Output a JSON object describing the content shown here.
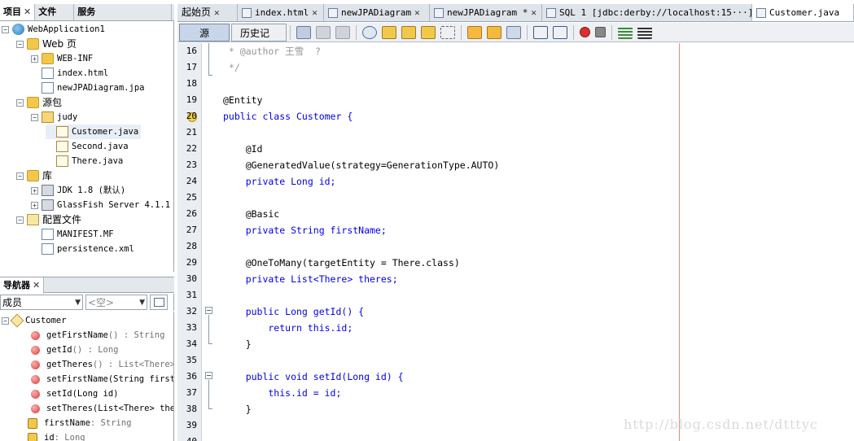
{
  "left_tabs": [
    {
      "label": "项目"
    },
    {
      "label": "文件"
    },
    {
      "label": "服务"
    }
  ],
  "project_tree": [
    {
      "label": "WebApplication1",
      "icon": "globe-icon"
    },
    {
      "label": "Web 页",
      "icon": "folder-icon"
    },
    {
      "label": "WEB-INF",
      "icon": "folder-icon"
    },
    {
      "label": "index.html",
      "icon": "page-icon"
    },
    {
      "label": "newJPADiagram.jpa",
      "icon": "page-icon"
    },
    {
      "label": "源包",
      "icon": "folder-icon"
    },
    {
      "label": "judy",
      "icon": "package-icon"
    },
    {
      "label": "Customer.java",
      "icon": "java-file-icon"
    },
    {
      "label": "Second.java",
      "icon": "java-file-icon"
    },
    {
      "label": "There.java",
      "icon": "java-file-icon"
    },
    {
      "label": "库",
      "icon": "library-icon"
    },
    {
      "label": "JDK 1.8 (默认)",
      "icon": "library-icon"
    },
    {
      "label": "GlassFish Server 4.1.1",
      "icon": "library-icon"
    },
    {
      "label": "配置文件",
      "icon": "config-icon"
    },
    {
      "label": "MANIFEST.MF",
      "icon": "page-icon"
    },
    {
      "label": "persistence.xml",
      "icon": "page-icon"
    }
  ],
  "navigator": {
    "tab_label": "导航器",
    "filter_value": "成员",
    "second_value": "<空>",
    "root": "Customer",
    "members": [
      {
        "name": "getFirstName",
        "sig": "() : String"
      },
      {
        "name": "getId",
        "sig": "() : Long"
      },
      {
        "name": "getTheres",
        "sig": "() : List<There>"
      },
      {
        "name": "setFirstName",
        "sig": "(String firstN"
      },
      {
        "name": "setId",
        "sig": "(Long id)"
      },
      {
        "name": "setTheres",
        "sig": "(List<There> ther"
      },
      {
        "name": "firstName",
        "sig": " : String"
      },
      {
        "name": "id",
        "sig": " : Long"
      }
    ]
  },
  "editor_tabs": [
    {
      "label": "起始页"
    },
    {
      "label": "index.html"
    },
    {
      "label": "newJPADiagram"
    },
    {
      "label": "newJPADiagram *"
    },
    {
      "label": "SQL 1 [jdbc:derby://localhost:15···]"
    },
    {
      "label": "Customer.java"
    }
  ],
  "toolbar": {
    "source_label": "源",
    "history_label": "历史记录"
  },
  "code_lines": [
    {
      "n": "16",
      "text": " * @author 王雪  ?"
    },
    {
      "n": "17",
      "text": " */"
    },
    {
      "n": "18",
      "text": ""
    },
    {
      "n": "19",
      "text": "@Entity"
    },
    {
      "n": "20",
      "text": "public class Customer {"
    },
    {
      "n": "21",
      "text": ""
    },
    {
      "n": "22",
      "text": "    @Id"
    },
    {
      "n": "23",
      "text": "    @GeneratedValue(strategy=GenerationType.AUTO)"
    },
    {
      "n": "24",
      "text": "    private Long id;"
    },
    {
      "n": "25",
      "text": ""
    },
    {
      "n": "26",
      "text": "    @Basic"
    },
    {
      "n": "27",
      "text": "    private String firstName;"
    },
    {
      "n": "28",
      "text": ""
    },
    {
      "n": "29",
      "text": "    @OneToMany(targetEntity = There.class)"
    },
    {
      "n": "30",
      "text": "    private List<There> theres;"
    },
    {
      "n": "31",
      "text": ""
    },
    {
      "n": "32",
      "text": "    public Long getId() {"
    },
    {
      "n": "33",
      "text": "        return this.id;"
    },
    {
      "n": "34",
      "text": "    }"
    },
    {
      "n": "35",
      "text": ""
    },
    {
      "n": "36",
      "text": "    public void setId(Long id) {"
    },
    {
      "n": "37",
      "text": "        this.id = id;"
    },
    {
      "n": "38",
      "text": "    }"
    },
    {
      "n": "39",
      "text": ""
    },
    {
      "n": "40",
      "text": ""
    }
  ],
  "watermark": "http://blog.csdn.net/dtttyc",
  "colors": {
    "keyword": "#0000e6",
    "field": "#009900",
    "comment": "#969696",
    "margin_line": "#e88888"
  }
}
